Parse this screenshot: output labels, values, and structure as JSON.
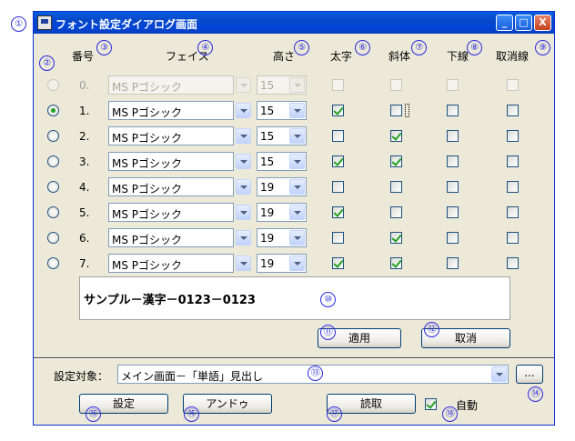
{
  "window": {
    "title": "フォント設定ダイアログ画面",
    "minimize": "_",
    "maximize": "□",
    "close": "X"
  },
  "headers": {
    "number": "番号",
    "face": "フェイス",
    "height": "高さ",
    "bold": "太字",
    "italic": "斜体",
    "underline": "下線",
    "strike": "取消線"
  },
  "rows": [
    {
      "index": "0.",
      "face": "MS Pゴシック",
      "size": "15",
      "bold": false,
      "italic": false,
      "underline": false,
      "strike": false,
      "selected": false,
      "disabled": true
    },
    {
      "index": "1.",
      "face": "MS Pゴシック",
      "size": "15",
      "bold": true,
      "italic": false,
      "underline": false,
      "strike": false,
      "selected": true,
      "disabled": false
    },
    {
      "index": "2.",
      "face": "MS Pゴシック",
      "size": "15",
      "bold": false,
      "italic": true,
      "underline": false,
      "strike": false,
      "selected": false,
      "disabled": false
    },
    {
      "index": "3.",
      "face": "MS Pゴシック",
      "size": "15",
      "bold": true,
      "italic": true,
      "underline": false,
      "strike": false,
      "selected": false,
      "disabled": false
    },
    {
      "index": "4.",
      "face": "MS Pゴシック",
      "size": "19",
      "bold": false,
      "italic": false,
      "underline": false,
      "strike": false,
      "selected": false,
      "disabled": false
    },
    {
      "index": "5.",
      "face": "MS Pゴシック",
      "size": "19",
      "bold": true,
      "italic": false,
      "underline": false,
      "strike": false,
      "selected": false,
      "disabled": false
    },
    {
      "index": "6.",
      "face": "MS Pゴシック",
      "size": "19",
      "bold": false,
      "italic": true,
      "underline": false,
      "strike": false,
      "selected": false,
      "disabled": false
    },
    {
      "index": "7.",
      "face": "MS Pゴシック",
      "size": "19",
      "bold": true,
      "italic": true,
      "underline": false,
      "strike": false,
      "selected": false,
      "disabled": false
    }
  ],
  "sample_text": "サンプル－漢字－0123－0123",
  "buttons": {
    "apply": "適用",
    "cancel": "取消",
    "browse": "...",
    "set": "設定",
    "undo": "アンドゥ",
    "read": "読取"
  },
  "target": {
    "label": "設定対象：",
    "value": "メイン画面－「単語」見出し"
  },
  "auto": {
    "label": "自動",
    "checked": true
  },
  "annotations": [
    "①",
    "②",
    "③",
    "④",
    "⑤",
    "⑥",
    "⑦",
    "⑧",
    "⑨",
    "⑩",
    "⑪",
    "⑫",
    "⑬",
    "⑭",
    "⑮",
    "⑯",
    "⑰",
    "⑱"
  ],
  "colors": {
    "title_bar": "#0a5ee0",
    "dialog_bg": "#ece9d8",
    "check": "#21a121",
    "annotation": "#2a2ae0"
  }
}
